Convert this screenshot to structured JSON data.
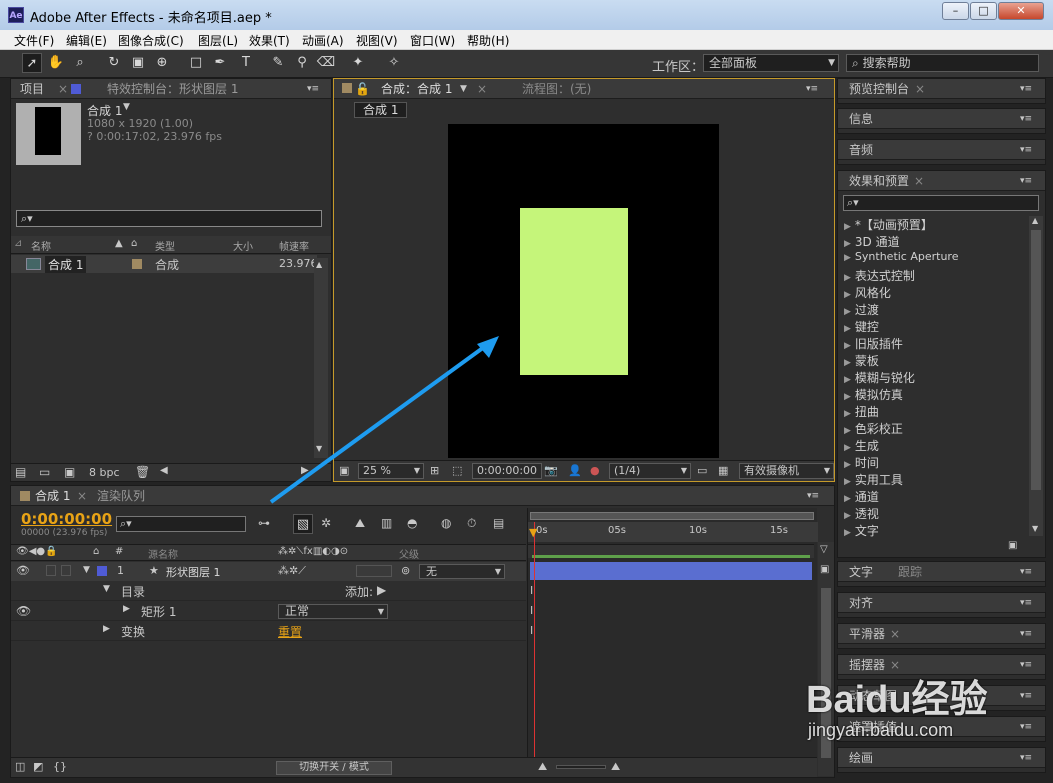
{
  "window": {
    "title": "Adobe After Effects - 未命名项目.aep *",
    "logo": "Ae",
    "min": "–",
    "max": "□",
    "close": "✕"
  },
  "menu": [
    "文件(F)",
    "编辑(E)",
    "图像合成(C)",
    "图层(L)",
    "效果(T)",
    "动画(A)",
    "视图(V)",
    "窗口(W)",
    "帮助(H)"
  ],
  "toolbar": {
    "workspace_label": "工作区：",
    "workspace_value": "全部面板",
    "search_help": "搜索帮助"
  },
  "project_panel": {
    "tab_project": "项目",
    "tab_effects": "特效控制台：形状图层 1",
    "comp_name": "合成 1",
    "comp_dims": "1080 x 1920 (1.00)",
    "comp_duration": "? 0:00:17:02, 23.976 fps",
    "col_name": "名称",
    "col_type": "类型",
    "col_size": "大小",
    "col_fps": "帧速率",
    "item_name": "合成 1",
    "item_type": "合成",
    "item_fps": "23.976",
    "bpc": "8 bpc"
  },
  "composition_panel": {
    "tab_comp": "合成：合成 1",
    "tab_flow": "流程图：(无)",
    "comp_chip": "合成 1",
    "zoom": "25 %",
    "timecode": "0:00:00:00",
    "resolution": "(1/4)",
    "camera": "有效摄像机",
    "canvas_color": "#000000",
    "shape_color": "#c5f57a"
  },
  "right_panels": {
    "preview": "预览控制台",
    "info": "信息",
    "audio": "音频",
    "effects_presets": "效果和预置",
    "effects_list": [
      "*【动画预置】",
      "3D 通道",
      "Synthetic Aperture",
      "表达式控制",
      "风格化",
      "过渡",
      "键控",
      "旧版插件",
      "蒙板",
      "模糊与锐化",
      "模拟仿真",
      "扭曲",
      "色彩校正",
      "生成",
      "时间",
      "实用工具",
      "通道",
      "透视",
      "文字"
    ],
    "text": "文字",
    "paragraph": "跟踪",
    "align": "对齐",
    "smoother": "平滑器",
    "wiggler": "摇摆器",
    "motion_sketch": "动态草图",
    "mask_interp": "遮罩插值",
    "paint": "绘画"
  },
  "timeline": {
    "tab_comp": "合成 1",
    "tab_render": "渲染队列",
    "timecode": "0:00:00:00",
    "frames": "00000 (23.976 fps)",
    "col_source": "源名称",
    "col_parent": "父级",
    "layer_num": "1",
    "layer_name": "形状图层 1",
    "parent_value": "无",
    "contents": "目录",
    "add_label": "添加:",
    "rect": "矩形 1",
    "blend_mode": "正常",
    "transform": "变换",
    "reset": "重置",
    "ruler": [
      "0s",
      "05s",
      "10s",
      "15s"
    ],
    "toggle_label": "切换开关 / 模式"
  },
  "watermark": {
    "brand": "Baidu经验",
    "url": "jingyan.baidu.com"
  }
}
